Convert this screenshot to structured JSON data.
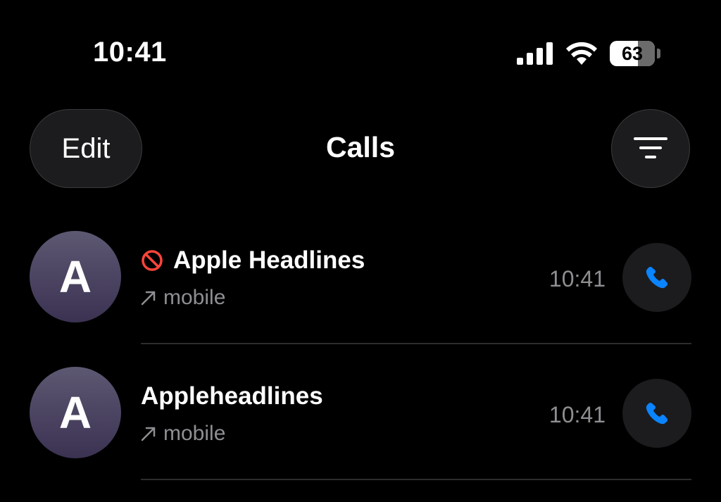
{
  "status_bar": {
    "time": "10:41",
    "battery_level": "63",
    "battery_fraction": 0.63,
    "signal_icon": "cellular-signal-icon",
    "wifi_icon": "wifi-icon",
    "battery_icon": "battery-icon"
  },
  "nav": {
    "edit_label": "Edit",
    "title": "Calls",
    "filter_icon": "filter-icon"
  },
  "calls": [
    {
      "initial": "A",
      "name": "Apple Headlines",
      "blocked": true,
      "type": "mobile",
      "direction": "outgoing",
      "time": "10:41"
    },
    {
      "initial": "A",
      "name": "Appleheadlines",
      "blocked": false,
      "type": "mobile",
      "direction": "outgoing",
      "time": "10:41"
    }
  ],
  "colors": {
    "background": "#000000",
    "accent": "#0a84ff",
    "blocked": "#ff453a",
    "secondary_text": "#8e8e93"
  }
}
